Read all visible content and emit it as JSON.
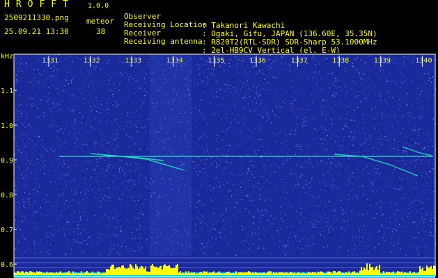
{
  "header": {
    "app_title": "HROFFT",
    "app_version": "1.0.0",
    "file_name": "2509211330.png",
    "meteor_label": "meteor",
    "date_time": "25.09.21 13:30",
    "meteor_count": "38",
    "info": [
      {
        "key": "Observer",
        "value": ": Takanori Kawachi"
      },
      {
        "key": "Receiving Location",
        "value": ": Ogaki, Gifu, JAPAN (136.60E, 35.35N)"
      },
      {
        "key": "Receiver",
        "value": ": R820T2(RTL-SDR) SDR-Sharp 53.1000MHz"
      },
      {
        "key": "Receiving antenna",
        "value": ": 2el-HB9CV Vertical (el. E-W)"
      }
    ]
  },
  "axes": {
    "y_unit": "kHz",
    "y_ticks": [
      "1.1",
      "1.0",
      "0.9",
      "0.8",
      "0.7",
      "0.6"
    ],
    "y_values": [
      1.1,
      1.0,
      0.9,
      0.8,
      0.7,
      0.6
    ],
    "x_ticks": [
      "1331",
      "1332",
      "1333",
      "1334",
      "1335",
      "1336",
      "1337",
      "1338",
      "1339",
      "1340"
    ],
    "x_values": [
      1331,
      1332,
      1333,
      1334,
      1335,
      1336,
      1337,
      1338,
      1339,
      1340
    ]
  },
  "colors": {
    "background_noise": "#1a2a9a",
    "trace": "#20e0c0",
    "carrier": "#40ffe0",
    "level_bars": "#ffff00",
    "level_base": "#00ccff",
    "axis_text": "#ffff00"
  }
}
